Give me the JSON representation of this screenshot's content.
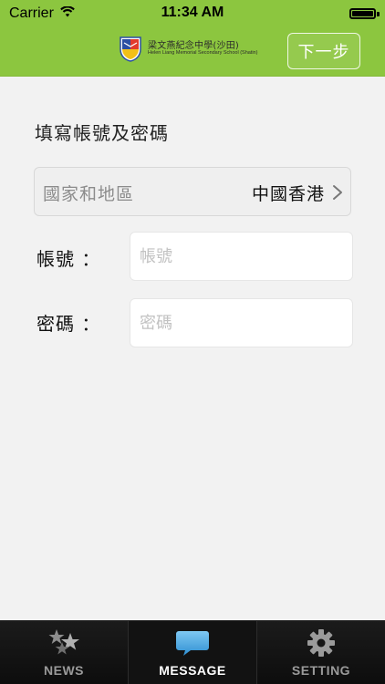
{
  "status_bar": {
    "carrier": "Carrier",
    "time": "11:34 AM"
  },
  "header": {
    "school_name_zh": "梁文燕紀念中學(沙田)",
    "school_name_en": "Helen Liang Memorial Secondary School (Shatin)",
    "next_label": "下一步",
    "accent_color": "#8cc63f"
  },
  "form": {
    "title": "填寫帳號及密碼",
    "region": {
      "label": "國家和地區",
      "value": "中國香港"
    },
    "account": {
      "label": "帳號 ：",
      "placeholder": "帳號",
      "value": ""
    },
    "password": {
      "label": "密碼 ：",
      "placeholder": "密碼",
      "value": ""
    }
  },
  "tabs": [
    {
      "label": "NEWS",
      "icon": "news-icon",
      "active": false
    },
    {
      "label": "MESSAGE",
      "icon": "message-icon",
      "active": true
    },
    {
      "label": "SETTING",
      "icon": "gear-icon",
      "active": false
    }
  ]
}
